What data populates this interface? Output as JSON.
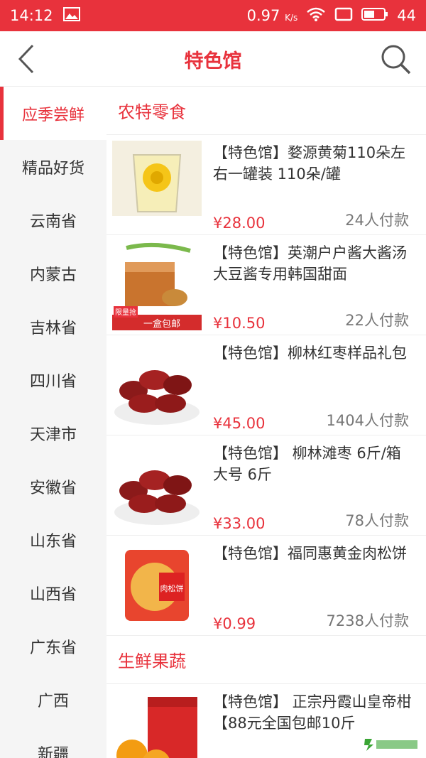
{
  "status": {
    "time": "14:12",
    "speed": "0.97",
    "speed_unit": "K/s",
    "battery": "44"
  },
  "header": {
    "title": "特色馆"
  },
  "sidebar": {
    "items": [
      {
        "label": "应季尝鲜",
        "active": true
      },
      {
        "label": "精品好货"
      },
      {
        "label": "云南省"
      },
      {
        "label": "内蒙古"
      },
      {
        "label": "吉林省"
      },
      {
        "label": "四川省"
      },
      {
        "label": "天津市"
      },
      {
        "label": "安徽省"
      },
      {
        "label": "山东省"
      },
      {
        "label": "山西省"
      },
      {
        "label": "广东省"
      },
      {
        "label": "广西"
      },
      {
        "label": "新疆"
      }
    ]
  },
  "sections": [
    {
      "title": "农特零食",
      "products": [
        {
          "name": "【特色馆】婺源黄菊110朵左右一罐装 110朵/罐",
          "price": "¥28.00",
          "sold": "24人付款",
          "thumb_icon": "chrysanthemum-tea-icon"
        },
        {
          "name": "【特色馆】英潮户户酱大酱汤大豆酱专用韩国甜面",
          "price": "¥10.50",
          "sold": "22人付款",
          "thumb_icon": "soybean-paste-icon"
        },
        {
          "name": "【特色馆】柳林红枣样品礼包",
          "price": "¥45.00",
          "sold": "1404人付款",
          "thumb_icon": "red-dates-icon"
        },
        {
          "name": "【特色馆】 柳林滩枣 6斤/箱 大号 6斤",
          "price": "¥33.00",
          "sold": "78人付款",
          "thumb_icon": "red-dates-icon"
        },
        {
          "name": "【特色馆】福同惠黄金肉松饼",
          "price": "¥0.99",
          "sold": "7238人付款",
          "thumb_icon": "pastry-icon"
        }
      ]
    },
    {
      "title": "生鲜果蔬",
      "products": [
        {
          "name": "【特色馆】 正宗丹霞山皇帝柑【88元全国包邮10斤",
          "price": "",
          "sold": "",
          "thumb_icon": "orange-box-icon"
        }
      ]
    }
  ],
  "thumb_labels": {
    "paste_banner": "一盒包邮",
    "paste_badge": "限量抢",
    "pastry_label": "肉松饼"
  },
  "colors": {
    "brand": "#e8323c",
    "sidebar_bg": "#f5f5f5"
  }
}
